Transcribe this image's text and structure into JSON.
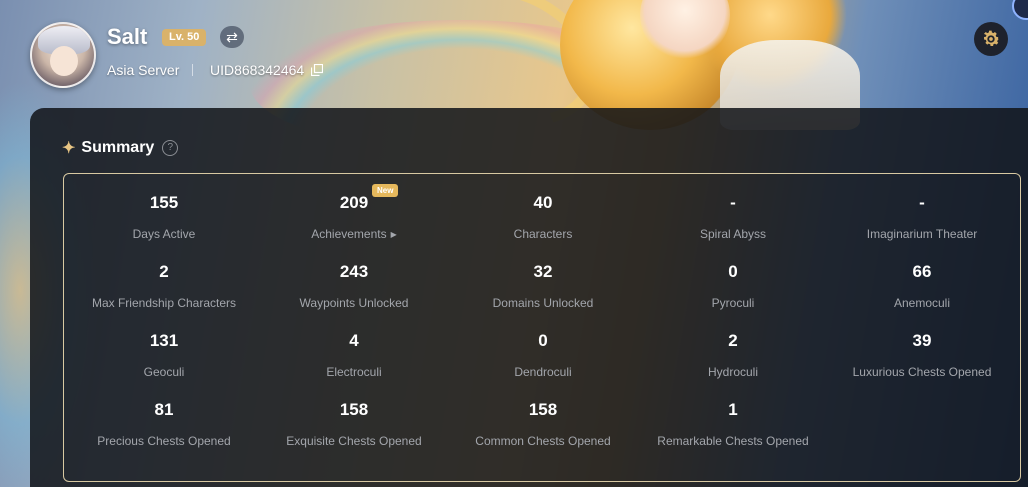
{
  "profile": {
    "name": "Salt",
    "level": "Lv. 50",
    "server": "Asia Server",
    "uid": "UID868342464"
  },
  "summary": {
    "title": "Summary",
    "new_badge": "New",
    "stats": [
      {
        "value": "155",
        "label": "Days Active"
      },
      {
        "value": "209",
        "label": "Achievements"
      },
      {
        "value": "40",
        "label": "Characters"
      },
      {
        "value": "-",
        "label": "Spiral Abyss"
      },
      {
        "value": "-",
        "label": "Imaginarium Theater"
      },
      {
        "value": "2",
        "label": "Max Friendship Characters"
      },
      {
        "value": "243",
        "label": "Waypoints Unlocked"
      },
      {
        "value": "32",
        "label": "Domains Unlocked"
      },
      {
        "value": "0",
        "label": "Pyroculi"
      },
      {
        "value": "66",
        "label": "Anemoculi"
      },
      {
        "value": "131",
        "label": "Geoculi"
      },
      {
        "value": "4",
        "label": "Electroculi"
      },
      {
        "value": "0",
        "label": "Dendroculi"
      },
      {
        "value": "2",
        "label": "Hydroculi"
      },
      {
        "value": "39",
        "label": "Luxurious Chests Opened"
      },
      {
        "value": "81",
        "label": "Precious Chests Opened"
      },
      {
        "value": "158",
        "label": "Exquisite Chests Opened"
      },
      {
        "value": "158",
        "label": "Common Chests Opened"
      },
      {
        "value": "1",
        "label": "Remarkable Chests Opened"
      }
    ]
  },
  "icons": {
    "switch": "swap-icon",
    "copy": "copy-icon",
    "settings": "gear-icon",
    "help": "question-icon",
    "title": "sparkle-icon"
  },
  "colors": {
    "level_badge": "#d9b26a",
    "new_badge": "#e5b85c",
    "panel_border": "#d8c9a2"
  }
}
